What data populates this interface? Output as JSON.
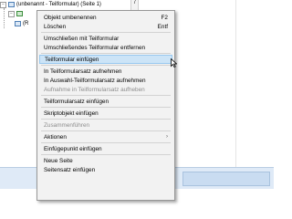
{
  "tree": {
    "expander_symbol": "−",
    "root_label": "(unbenannt - Teilformular) (Seite 1)",
    "child_prefix": "(R"
  },
  "editor": {
    "ruler_mark": "7"
  },
  "context_menu": {
    "items": [
      {
        "label": "Objekt umbenennen",
        "shortcut": "F2"
      },
      {
        "label": "Löschen",
        "shortcut": "Entf"
      },
      {
        "label": "Umschließen mit Teilformular",
        "shortcut": ""
      },
      {
        "label": "Umschließendes Teilformular entfernen",
        "shortcut": ""
      },
      {
        "label": "Teilformular einfügen",
        "shortcut": "",
        "highlighted": true
      },
      {
        "label": "In Teilformularsatz aufnehmen",
        "shortcut": ""
      },
      {
        "label": "In Auswahl-Teilformularsatz aufnehmen",
        "shortcut": ""
      },
      {
        "label": "Aufnahme in Teilformularsatz aufheben",
        "shortcut": "",
        "disabled": true
      },
      {
        "label": "Teilformularsatz einfügen",
        "shortcut": ""
      },
      {
        "label": "Skriptobjekt einfügen",
        "shortcut": ""
      },
      {
        "label": "Zusammenführen",
        "shortcut": "",
        "disabled": true
      },
      {
        "label": "Aktionen",
        "submenu_arrow": "›"
      },
      {
        "label": "Einfügepunkt einfügen",
        "shortcut": ""
      },
      {
        "label": "Neue Seite",
        "shortcut": ""
      },
      {
        "label": "Seitensatz einfügen",
        "shortcut": ""
      }
    ]
  },
  "colors": {
    "highlight_bg": "#cce4f7",
    "highlight_border": "#99c9ef",
    "menu_bg": "#f2f2f2",
    "disabled_text": "#8c8c8c"
  }
}
